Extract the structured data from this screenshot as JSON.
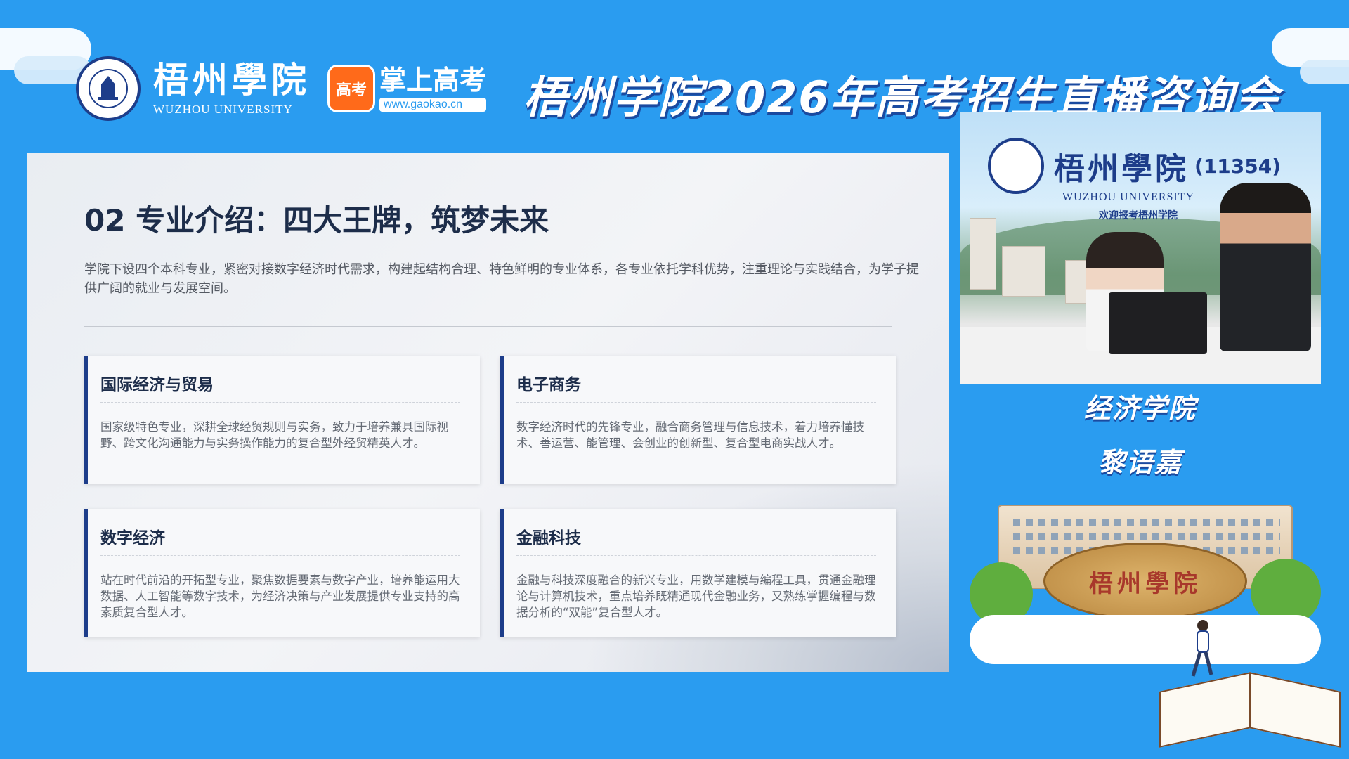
{
  "header": {
    "university_cn": "梧州學院",
    "university_en": "WUZHOU UNIVERSITY",
    "partner_badge": "高考",
    "partner_cn": "掌上高考",
    "partner_url": "www.gaokao.cn",
    "event_title": "梧州学院2026年高考招生直播咨询会"
  },
  "slide": {
    "title": "02 专业介绍：四大王牌，筑梦未来",
    "intro": "学院下设四个本科专业，紧密对接数字经济时代需求，构建起结构合理、特色鲜明的专业体系，各专业依托学科优势，注重理论与实践结合，为学子提供广阔的就业与发展空间。",
    "majors": [
      {
        "name": "国际经济与贸易",
        "desc": "国家级特色专业，深耕全球经贸规则与实务，致力于培养兼具国际视野、跨文化沟通能力与实务操作能力的复合型外经贸精英人才。"
      },
      {
        "name": "电子商务",
        "desc": "数字经济时代的先锋专业，融合商务管理与信息技术，着力培养懂技术、善运营、能管理、会创业的创新型、复合型电商实战人才。"
      },
      {
        "name": "数字经济",
        "desc": "站在时代前沿的开拓型专业，聚焦数据要素与数字产业，培养能运用大数据、人工智能等数字技术，为经济决策与产业发展提供专业支持的高素质复合型人才。"
      },
      {
        "name": "金融科技",
        "desc": "金融与科技深度融合的新兴专业，用数学建模与编程工具，贯通金融理论与计算机技术，重点培养既精通现代金融业务，又熟练掌握编程与数据分析的“双能”复合型人才。"
      }
    ]
  },
  "video": {
    "school_cn": "梧州學院",
    "school_code": "(11354)",
    "school_en": "WUZHOU UNIVERSITY",
    "welcome": "欢迎报考梧州学院"
  },
  "speaker": {
    "department": "经济学院",
    "name": "黎语嘉"
  },
  "campus": {
    "rock_text": "梧州學院"
  },
  "colors": {
    "background": "#2a9cf0",
    "navy": "#1d3d8a",
    "accent_orange": "#ff6a1a"
  },
  "icons": [
    "university-seal-icon",
    "gaokao-logo-icon"
  ]
}
